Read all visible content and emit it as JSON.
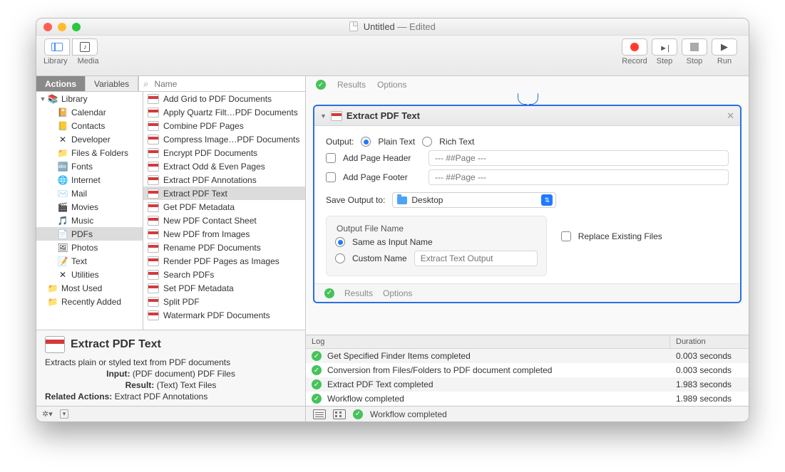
{
  "title": {
    "name": "Untitled",
    "state": "Edited"
  },
  "toolbar": {
    "library": "Library",
    "media": "Media",
    "record": "Record",
    "step": "Step",
    "stop": "Stop",
    "run": "Run"
  },
  "tabs": {
    "actions": "Actions",
    "variables": "Variables",
    "search_placeholder": "Name"
  },
  "traffic": {
    "close": "#ff5f57",
    "min": "#ffbd2e",
    "max": "#28c940"
  },
  "library": [
    {
      "label": "Library",
      "level": 1,
      "icon": "📚",
      "expand": "▼"
    },
    {
      "label": "Calendar",
      "level": 2,
      "icon": "📔"
    },
    {
      "label": "Contacts",
      "level": 2,
      "icon": "📒"
    },
    {
      "label": "Developer",
      "level": 2,
      "icon": "✕"
    },
    {
      "label": "Files & Folders",
      "level": 2,
      "icon": "📁"
    },
    {
      "label": "Fonts",
      "level": 2,
      "icon": "🔤"
    },
    {
      "label": "Internet",
      "level": 2,
      "icon": "🌐"
    },
    {
      "label": "Mail",
      "level": 2,
      "icon": "✉️"
    },
    {
      "label": "Movies",
      "level": 2,
      "icon": "🎬"
    },
    {
      "label": "Music",
      "level": 2,
      "icon": "🎵"
    },
    {
      "label": "PDFs",
      "level": 2,
      "icon": "📄",
      "selected": true
    },
    {
      "label": "Photos",
      "level": 2,
      "icon": "🖼"
    },
    {
      "label": "Text",
      "level": 2,
      "icon": "📝"
    },
    {
      "label": "Utilities",
      "level": 2,
      "icon": "✕"
    },
    {
      "label": "Most Used",
      "level": 1,
      "icon": "📁"
    },
    {
      "label": "Recently Added",
      "level": 1,
      "icon": "📁"
    }
  ],
  "actions": [
    "Add Grid to PDF Documents",
    "Apply Quartz Filt…PDF Documents",
    "Combine PDF Pages",
    "Compress Image…PDF Documents",
    "Encrypt PDF Documents",
    "Extract Odd & Even Pages",
    "Extract PDF Annotations",
    "Extract PDF Text",
    "Get PDF Metadata",
    "New PDF Contact Sheet",
    "New PDF from Images",
    "Rename PDF Documents",
    "Render PDF Pages as Images",
    "Search PDFs",
    "Set PDF Metadata",
    "Split PDF",
    "Watermark PDF Documents"
  ],
  "selected_action_index": 7,
  "desc": {
    "title": "Extract PDF Text",
    "summary": "Extracts plain or styled text from PDF documents",
    "input_label": "Input:",
    "input_value": "(PDF document) PDF Files",
    "result_label": "Result:",
    "result_value": "(Text) Text Files",
    "related_label": "Related Actions:",
    "related_value": "Extract PDF Annotations"
  },
  "card": {
    "title": "Extract PDF Text",
    "output_label": "Output:",
    "plain": "Plain Text",
    "rich": "Rich Text",
    "add_header": "Add Page Header",
    "header_ph": "--- ##Page ---",
    "add_footer": "Add Page Footer",
    "footer_ph": "--- ##Page ---",
    "save_to": "Save Output to:",
    "save_dest": "Desktop",
    "filename_group": "Output File Name",
    "same_name": "Same as Input Name",
    "custom_name": "Custom Name",
    "custom_ph": "Extract Text Output",
    "replace": "Replace Existing Files",
    "results": "Results",
    "options": "Options"
  },
  "log": {
    "col1": "Log",
    "col2": "Duration",
    "rows": [
      {
        "msg": "Get Specified Finder Items completed",
        "dur": "0.003 seconds"
      },
      {
        "msg": "Conversion from Files/Folders to PDF document completed",
        "dur": "0.003 seconds"
      },
      {
        "msg": "Extract PDF Text completed",
        "dur": "1.983 seconds"
      },
      {
        "msg": "Workflow completed",
        "dur": "1.989 seconds"
      }
    ]
  },
  "status": "Workflow completed"
}
